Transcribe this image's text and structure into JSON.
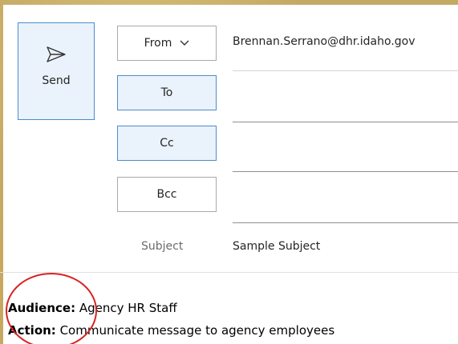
{
  "compose": {
    "send_label": "Send",
    "from_label": "From",
    "from_value": "Brennan.Serrano@dhr.idaho.gov",
    "to_label": "To",
    "to_value": "",
    "cc_label": "Cc",
    "cc_value": "",
    "bcc_label": "Bcc",
    "bcc_value": "",
    "subject_label": "Subject",
    "subject_value": "Sample Subject"
  },
  "body": {
    "audience_label": "Audience:",
    "audience_value": " Agency HR Staff",
    "action_label": "Action:",
    "action_value": " Communicate message to agency employees"
  },
  "colors": {
    "accent": "#4d8cc9",
    "selected_bg": "#eaf3fb",
    "annotation_circle": "#d92323"
  },
  "icons": {
    "send": "send-icon",
    "from_dropdown": "chevron-down-icon"
  }
}
